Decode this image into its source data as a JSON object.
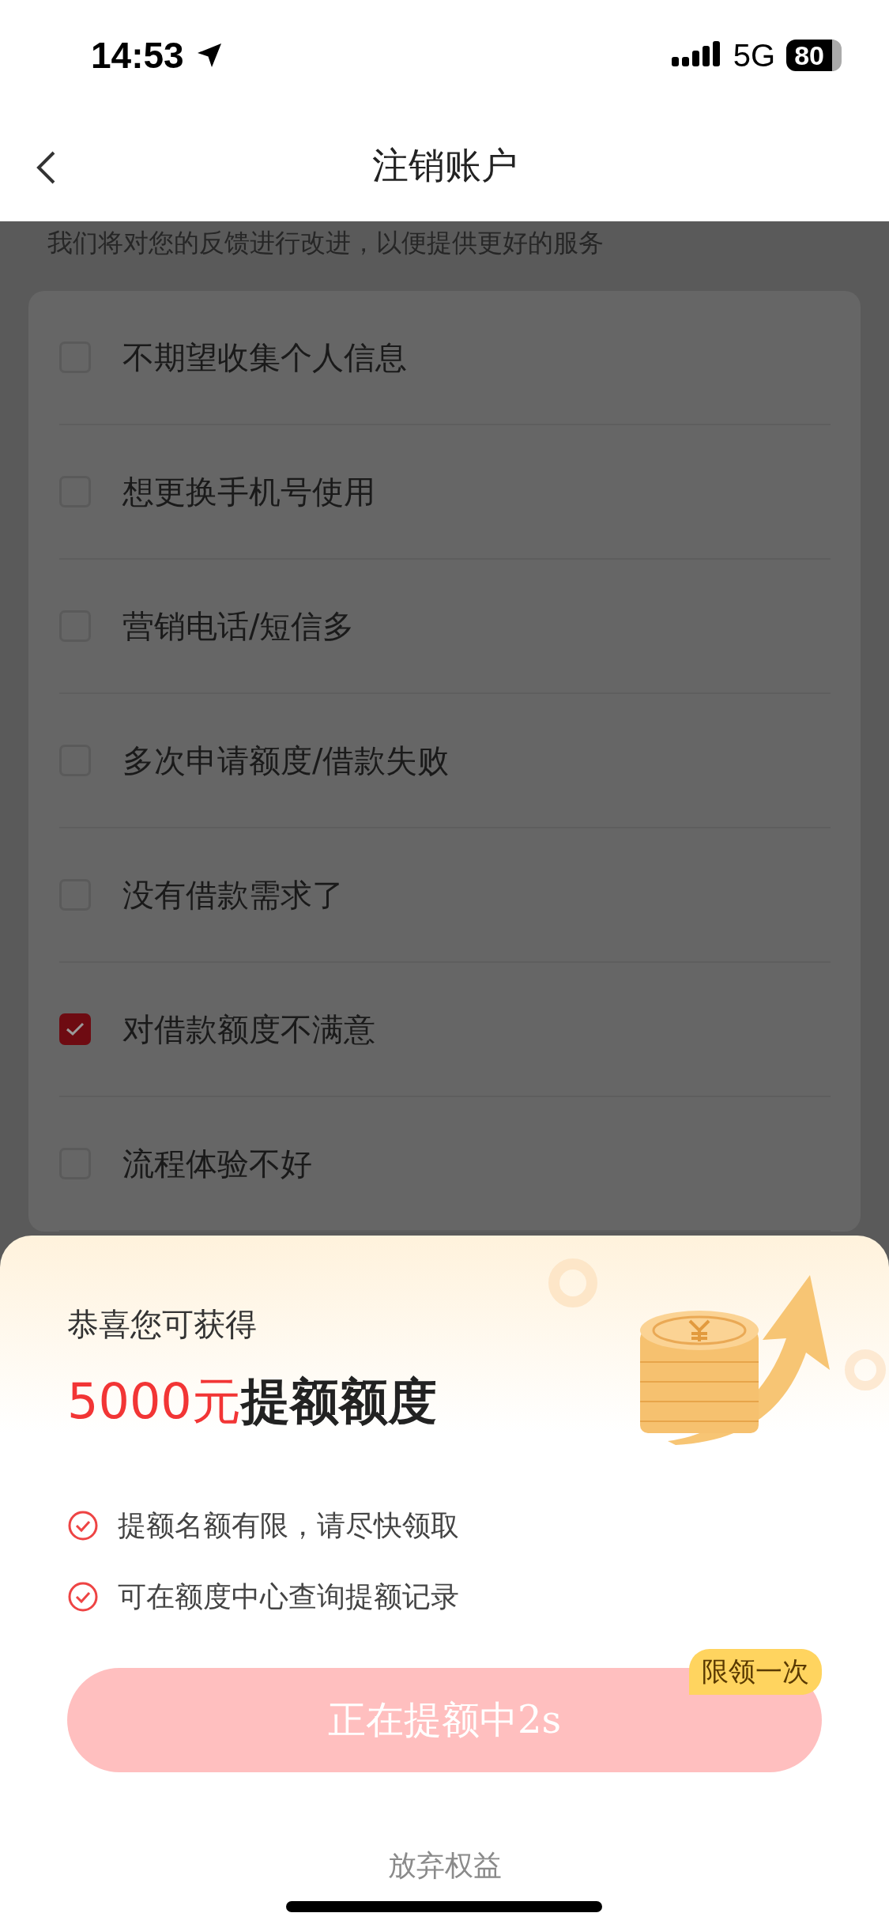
{
  "status_bar": {
    "time": "14:53",
    "network": "5G",
    "battery": "80"
  },
  "nav": {
    "title": "注销账户"
  },
  "subtitle": "我们将对您的反馈进行改进，以便提供更好的服务",
  "reasons": [
    {
      "label": "不期望收集个人信息",
      "checked": false
    },
    {
      "label": "想更换手机号使用",
      "checked": false
    },
    {
      "label": "营销电话/短信多",
      "checked": false
    },
    {
      "label": "多次申请额度/借款失败",
      "checked": false
    },
    {
      "label": "没有借款需求了",
      "checked": false
    },
    {
      "label": "对借款额度不满意",
      "checked": true
    },
    {
      "label": "流程体验不好",
      "checked": false
    }
  ],
  "offer_sheet": {
    "greeting": "恭喜您可获得",
    "amount": "5000元",
    "amount_label": "提额额度",
    "benefits": [
      "提额名额有限，请尽快领取",
      "可在额度中心查询提额记录"
    ],
    "button": {
      "label": "正在提额中2s",
      "badge": "限领一次"
    },
    "dismiss": "放弃权益"
  }
}
